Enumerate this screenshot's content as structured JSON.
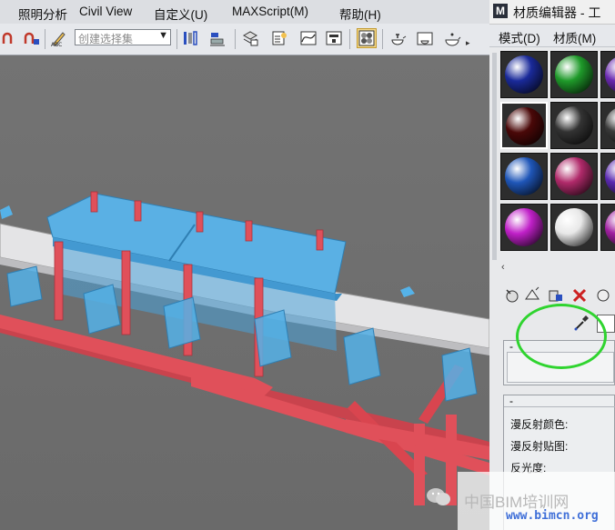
{
  "main_menu": {
    "items": [
      "照明分析",
      "Civil View",
      "自定义(U)",
      "MAXScript(M)",
      "帮助(H)"
    ]
  },
  "main_toolbar": {
    "selection_set_placeholder": "创建选择集"
  },
  "material_editor": {
    "title": "材质编辑器 - 工",
    "logo": "M",
    "menu": [
      "模式(D)",
      "材质(M)"
    ],
    "slot_colors": [
      [
        "#1a2a9a",
        "#1f9a2a",
        "#6a2ab0"
      ],
      [
        "#4a0808",
        "#333333",
        "#3a3a3a"
      ],
      [
        "#1f56b8",
        "#b02a6a",
        "#5a2ab0"
      ],
      [
        "#c020c8",
        "#e8e8e8",
        "#a020a0"
      ]
    ],
    "collapse_arrow": "‹",
    "rollout_minus": "-",
    "params": {
      "diffuse_color": "漫反射颜色:",
      "diffuse_map": "漫反射贴图:",
      "gloss": "反光度:"
    }
  },
  "watermark": {
    "cn_text": "中国BIM培训网",
    "url": "www.bimcn.org"
  },
  "colors": {
    "frame_red": "#e0505a",
    "cover_blue": "#4aa3d8",
    "highlight_green": "#2fd42f"
  }
}
